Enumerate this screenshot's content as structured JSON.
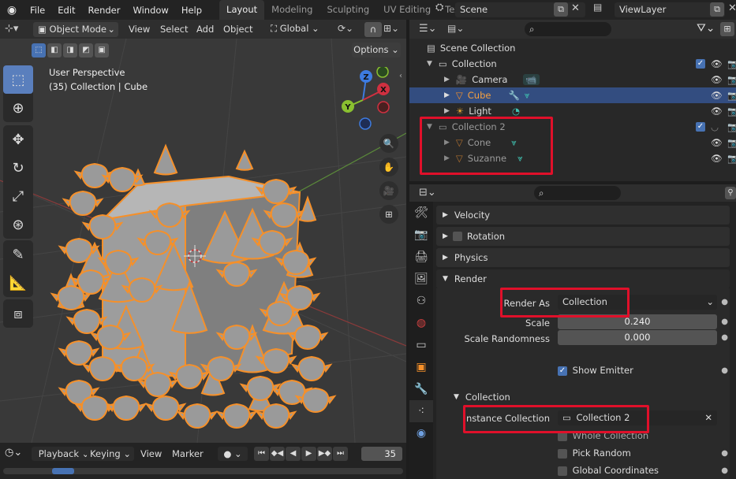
{
  "topbar": {
    "menu": [
      "File",
      "Edit",
      "Render",
      "Window",
      "Help"
    ],
    "workspaces": [
      "Layout",
      "Modeling",
      "Sculpting",
      "UV Editing",
      "Textu"
    ],
    "active_workspace": "Layout",
    "scene": "Scene",
    "view_layer": "ViewLayer"
  },
  "viewport": {
    "mode": "Object Mode",
    "menus": [
      "View",
      "Select",
      "Add",
      "Object"
    ],
    "transform": "Global",
    "options": "Options",
    "info_line1": "User Perspective",
    "info_line2": "(35) Collection | Cube",
    "gizmo": {
      "x": "X",
      "y": "Y",
      "z": "Z"
    }
  },
  "outliner": {
    "search_placeholder": "",
    "rows": [
      {
        "label": "Scene Collection",
        "indent": 0,
        "type": "scene"
      },
      {
        "label": "Collection",
        "indent": 1,
        "type": "collection"
      },
      {
        "label": "Camera",
        "indent": 2,
        "type": "camera"
      },
      {
        "label": "Cube",
        "indent": 2,
        "type": "mesh",
        "selected": true
      },
      {
        "label": "Light",
        "indent": 2,
        "type": "light"
      },
      {
        "label": "Collection 2",
        "indent": 1,
        "type": "collection",
        "dim": true
      },
      {
        "label": "Cone",
        "indent": 2,
        "type": "mesh",
        "dim": true
      },
      {
        "label": "Suzanne",
        "indent": 2,
        "type": "mesh",
        "dim": true
      }
    ]
  },
  "properties": {
    "panels": {
      "velocity": "Velocity",
      "rotation": "Rotation",
      "physics": "Physics",
      "render": "Render",
      "collection": "Collection"
    },
    "render_as_label": "Render As",
    "render_as_value": "Collection",
    "scale_label": "Scale",
    "scale_value": "0.240",
    "scale_rand_label": "Scale Randomness",
    "scale_rand_value": "0.000",
    "show_emitter": "Show Emitter",
    "instance_collection_label": "Instance Collection",
    "instance_collection_value": "Collection 2",
    "whole_collection": "Whole Collection",
    "pick_random": "Pick Random",
    "global_coordinates": "Global Coordinates"
  },
  "timeline": {
    "menus": [
      "Playback",
      "Keying",
      "View",
      "Marker"
    ],
    "frame": "35"
  },
  "colors": {
    "accent": "#4772b3",
    "highlight": "#e0102a",
    "selection_outline": "#f5902a"
  }
}
